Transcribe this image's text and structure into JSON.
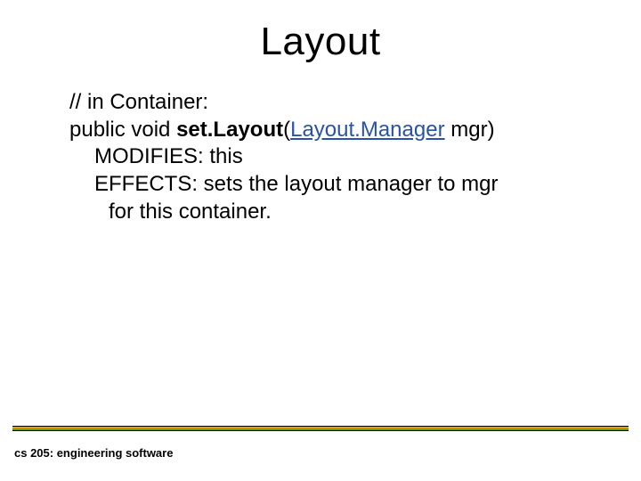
{
  "title": "Layout",
  "code": {
    "l1": "// in Container:",
    "l2a": "public void ",
    "l2b": "set.Layout",
    "l2c": "(",
    "l2d": "Layout.Manager",
    "l2e": " mgr)",
    "l3": "MODIFIES: this",
    "l4": "EFFECTS: sets the layout manager to mgr",
    "l5": "for this container."
  },
  "footer": "cs 205: engineering software"
}
